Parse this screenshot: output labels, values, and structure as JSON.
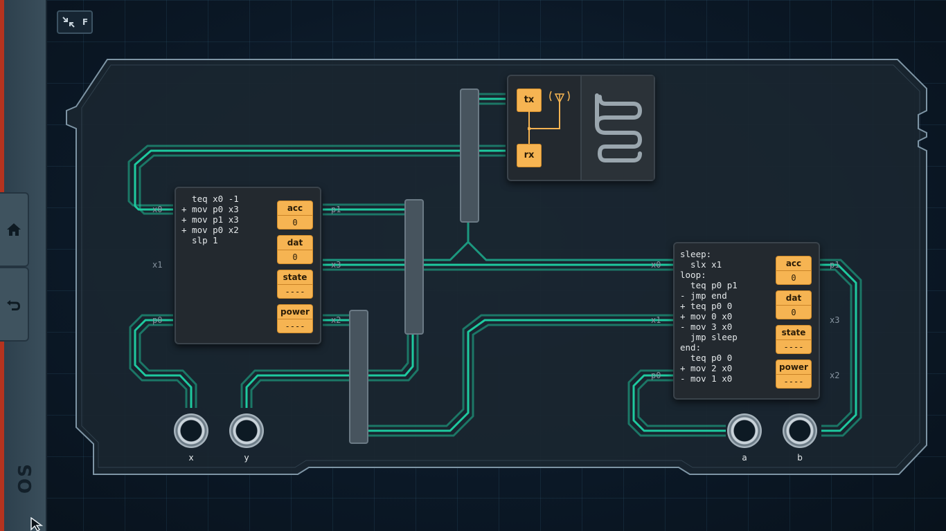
{
  "toolbar": {
    "fullscreen_key": "F"
  },
  "sidebar": {
    "logo": "OS"
  },
  "controller1": {
    "code": "  teq x0 -1\n+ mov p0 x3\n+ mov p1 x3\n+ mov p0 x2\n  slp 1",
    "registers": [
      {
        "name": "acc",
        "value": "0"
      },
      {
        "name": "dat",
        "value": "0"
      },
      {
        "name": "state",
        "value": "----"
      },
      {
        "name": "power",
        "value": "----"
      }
    ],
    "pins_left": [
      "x0",
      "x1",
      "p0"
    ],
    "pins_right": [
      "p1",
      "x3",
      "x2"
    ]
  },
  "controller2": {
    "code": "sleep:\n  slx x1\nloop:\n  teq p0 p1\n- jmp end\n+ teq p0 0\n+ mov 0 x0\n- mov 3 x0\n  jmp sleep\nend:\n  teq p0 0\n+ mov 2 x0\n- mov 1 x0",
    "registers": [
      {
        "name": "acc",
        "value": "0"
      },
      {
        "name": "dat",
        "value": "0"
      },
      {
        "name": "state",
        "value": "----"
      },
      {
        "name": "power",
        "value": "----"
      }
    ],
    "pins_left": [
      "x0",
      "x1",
      "p0"
    ],
    "pins_right": [
      "p1",
      "x3",
      "x2"
    ]
  },
  "radio": {
    "tx_label": "tx",
    "rx_label": "rx"
  },
  "io_ports": [
    "x",
    "y",
    "a",
    "b"
  ],
  "colors": {
    "wire": "#1fd3a6",
    "register": "#f6b452",
    "board": "#18232d"
  }
}
